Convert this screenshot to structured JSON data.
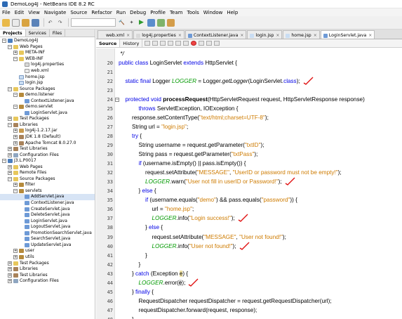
{
  "window": {
    "title": "DemoLog4J - NetBeans IDE 8.2 RC"
  },
  "menubar": [
    "File",
    "Edit",
    "View",
    "Navigate",
    "Source",
    "Refactor",
    "Run",
    "Debug",
    "Profile",
    "Team",
    "Tools",
    "Window",
    "Help"
  ],
  "left_tabs": [
    "Projects",
    "Services",
    "Files"
  ],
  "tree": [
    {
      "label": "DemoLog4J",
      "toggle": "−",
      "icon": "proj"
    },
    {
      "label": "Web Pages",
      "toggle": "−",
      "icon": "folder"
    },
    {
      "label": "META-INF",
      "toggle": "+",
      "icon": "folder"
    },
    {
      "label": "WEB-INF",
      "toggle": "−",
      "icon": "folder"
    },
    {
      "label": "log4j.properties",
      "toggle": "",
      "icon": "prop"
    },
    {
      "label": "web.xml",
      "toggle": "",
      "icon": "xml"
    },
    {
      "label": "home.jsp",
      "toggle": "",
      "icon": "jsp"
    },
    {
      "label": "login.jsp",
      "toggle": "",
      "icon": "jsp"
    },
    {
      "label": "Source Packages",
      "toggle": "−",
      "icon": "folder"
    },
    {
      "label": "demo.listener",
      "toggle": "−",
      "icon": "pkg"
    },
    {
      "label": "ContextListener.java",
      "toggle": "",
      "icon": "java"
    },
    {
      "label": "demo.servlet",
      "toggle": "−",
      "icon": "pkg"
    },
    {
      "label": "LoginServlet.java",
      "toggle": "",
      "icon": "java"
    },
    {
      "label": "Test Packages",
      "toggle": "+",
      "icon": "folder"
    },
    {
      "label": "Libraries",
      "toggle": "−",
      "icon": "lib"
    },
    {
      "label": "log4j-1.2.17.jar",
      "toggle": "+",
      "icon": "jar"
    },
    {
      "label": "JDK 1.8 (Default)",
      "toggle": "+",
      "icon": "lib"
    },
    {
      "label": "Apache Tomcat 8.0.27.0",
      "toggle": "+",
      "icon": "lib"
    },
    {
      "label": "Test Libraries",
      "toggle": "+",
      "icon": "lib"
    },
    {
      "label": "Configuration Files",
      "toggle": "+",
      "icon": "cfg"
    },
    {
      "label": "J3.L.P0017",
      "toggle": "−",
      "icon": "proj"
    },
    {
      "label": "Web Pages",
      "toggle": "+",
      "icon": "folder"
    },
    {
      "label": "Remote Files",
      "toggle": "+",
      "icon": "folder"
    },
    {
      "label": "Source Packages",
      "toggle": "−",
      "icon": "folder"
    },
    {
      "label": "filter",
      "toggle": "+",
      "icon": "pkg"
    },
    {
      "label": "servlets",
      "toggle": "−",
      "icon": "pkg"
    },
    {
      "label": "AddServlet.java",
      "toggle": "",
      "icon": "java"
    },
    {
      "label": "ContextListener.java",
      "toggle": "",
      "icon": "java"
    },
    {
      "label": "CreateServlet.java",
      "toggle": "",
      "icon": "java"
    },
    {
      "label": "DeleteServlet.java",
      "toggle": "",
      "icon": "java"
    },
    {
      "label": "LoginServlet.java",
      "toggle": "",
      "icon": "java"
    },
    {
      "label": "LogoutServlet.java",
      "toggle": "",
      "icon": "java"
    },
    {
      "label": "PromotionSearchServlet.java",
      "toggle": "",
      "icon": "java"
    },
    {
      "label": "SearchServlet.java",
      "toggle": "",
      "icon": "java"
    },
    {
      "label": "UpdateServlet.java",
      "toggle": "",
      "icon": "java"
    },
    {
      "label": "user",
      "toggle": "+",
      "icon": "pkg"
    },
    {
      "label": "utils",
      "toggle": "+",
      "icon": "pkg"
    },
    {
      "label": "Test Packages",
      "toggle": "+",
      "icon": "folder"
    },
    {
      "label": "Libraries",
      "toggle": "+",
      "icon": "lib"
    },
    {
      "label": "Test Libraries",
      "toggle": "+",
      "icon": "lib"
    },
    {
      "label": "Configuration Files",
      "toggle": "+",
      "icon": "cfg"
    }
  ],
  "file_tabs": [
    {
      "label": "web.xml",
      "active": false
    },
    {
      "label": "log4j.properties",
      "active": false
    },
    {
      "label": "ContextListener.java",
      "active": false
    },
    {
      "label": "login.jsp",
      "active": false
    },
    {
      "label": "home.jsp",
      "active": false
    },
    {
      "label": "LoginServlet.java",
      "active": true
    }
  ],
  "editor_modes": [
    "Source",
    "History"
  ],
  "code_lines": [
    {
      "n": "",
      "indent": 0,
      "fold": "",
      "mark": false,
      "seg": [
        {
          "t": " */",
          "c": "em"
        }
      ]
    },
    {
      "n": "20",
      "indent": 0,
      "fold": "",
      "mark": false,
      "seg": [
        {
          "t": "public class ",
          "c": "kw"
        },
        {
          "t": "LoginServlet ",
          "c": ""
        },
        {
          "t": "extends ",
          "c": "kw"
        },
        {
          "t": "HttpServlet {",
          "c": ""
        }
      ]
    },
    {
      "n": "21",
      "indent": 0,
      "fold": "",
      "mark": false,
      "seg": []
    },
    {
      "n": "22",
      "indent": 1,
      "fold": "",
      "mark": true,
      "seg": [
        {
          "t": "static final ",
          "c": "kw"
        },
        {
          "t": "Logger ",
          "c": ""
        },
        {
          "t": "LOGGER",
          "c": "fld"
        },
        {
          "t": " = Logger.",
          "c": ""
        },
        {
          "t": "getLogger",
          "c": "em"
        },
        {
          "t": "(LoginServlet.",
          "c": ""
        },
        {
          "t": "class",
          "c": "kw"
        },
        {
          "t": ");",
          "c": ""
        }
      ]
    },
    {
      "n": "23",
      "indent": 0,
      "fold": "",
      "mark": false,
      "seg": []
    },
    {
      "n": "24",
      "indent": 1,
      "fold": "−",
      "mark": false,
      "seg": [
        {
          "t": "protected void ",
          "c": "kw"
        },
        {
          "t": "processRequest",
          "c": "b"
        },
        {
          "t": "(HttpServletRequest request, HttpServletResponse response)",
          "c": ""
        }
      ]
    },
    {
      "n": "25",
      "indent": 3,
      "fold": "",
      "mark": false,
      "seg": [
        {
          "t": "throws ",
          "c": "kw"
        },
        {
          "t": "ServletException, IOException {",
          "c": ""
        }
      ]
    },
    {
      "n": "26",
      "indent": 2,
      "fold": "",
      "mark": false,
      "seg": [
        {
          "t": "response.setContentType(",
          "c": ""
        },
        {
          "t": "\"text/html;charset=UTF-8\"",
          "c": "str"
        },
        {
          "t": ");",
          "c": ""
        }
      ]
    },
    {
      "n": "27",
      "indent": 2,
      "fold": "",
      "mark": false,
      "seg": [
        {
          "t": "String url = ",
          "c": ""
        },
        {
          "t": "\"login.jsp\"",
          "c": "str"
        },
        {
          "t": ";",
          "c": ""
        }
      ]
    },
    {
      "n": "28",
      "indent": 2,
      "fold": "",
      "mark": false,
      "seg": [
        {
          "t": "try ",
          "c": "kw"
        },
        {
          "t": "{",
          "c": ""
        }
      ]
    },
    {
      "n": "29",
      "indent": 3,
      "fold": "",
      "mark": false,
      "seg": [
        {
          "t": "String username = request.getParameter(",
          "c": ""
        },
        {
          "t": "\"txtID\"",
          "c": "str"
        },
        {
          "t": ");",
          "c": ""
        }
      ]
    },
    {
      "n": "30",
      "indent": 3,
      "fold": "",
      "mark": false,
      "seg": [
        {
          "t": "String pass = request.getParameter(",
          "c": ""
        },
        {
          "t": "\"txtPass\"",
          "c": "str"
        },
        {
          "t": ");",
          "c": ""
        }
      ]
    },
    {
      "n": "31",
      "indent": 3,
      "fold": "",
      "mark": false,
      "seg": [
        {
          "t": "if ",
          "c": "kw"
        },
        {
          "t": "(username.isEmpty() || pass.isEmpty()) {",
          "c": ""
        }
      ]
    },
    {
      "n": "32",
      "indent": 4,
      "fold": "",
      "mark": false,
      "seg": [
        {
          "t": "request.setAttribute(",
          "c": ""
        },
        {
          "t": "\"MESSAGE\"",
          "c": "str"
        },
        {
          "t": ", ",
          "c": ""
        },
        {
          "t": "\"UserID or password must not be empty!\"",
          "c": "str"
        },
        {
          "t": ");",
          "c": ""
        }
      ]
    },
    {
      "n": "33",
      "indent": 4,
      "fold": "",
      "mark": true,
      "seg": [
        {
          "t": "LOGGER",
          "c": "fld"
        },
        {
          "t": ".warn(",
          "c": ""
        },
        {
          "t": "\"User not fill in userID or Password!\"",
          "c": "str"
        },
        {
          "t": ");",
          "c": ""
        }
      ]
    },
    {
      "n": "34",
      "indent": 3,
      "fold": "",
      "mark": false,
      "seg": [
        {
          "t": "} ",
          "c": ""
        },
        {
          "t": "else ",
          "c": "kw"
        },
        {
          "t": "{",
          "c": ""
        }
      ]
    },
    {
      "n": "35",
      "indent": 4,
      "fold": "",
      "mark": false,
      "seg": [
        {
          "t": "if ",
          "c": "kw"
        },
        {
          "t": "(username.equals(",
          "c": ""
        },
        {
          "t": "\"demo\"",
          "c": "str"
        },
        {
          "t": ") && pass.equals(",
          "c": ""
        },
        {
          "t": "\"password\"",
          "c": "str"
        },
        {
          "t": ")) {",
          "c": ""
        }
      ]
    },
    {
      "n": "36",
      "indent": 5,
      "fold": "",
      "mark": false,
      "seg": [
        {
          "t": "url = ",
          "c": ""
        },
        {
          "t": "\"home.jsp\"",
          "c": "str"
        },
        {
          "t": ";",
          "c": ""
        }
      ]
    },
    {
      "n": "37",
      "indent": 5,
      "fold": "",
      "mark": true,
      "seg": [
        {
          "t": "LOGGER",
          "c": "fld"
        },
        {
          "t": ".info(",
          "c": ""
        },
        {
          "t": "\"Login success!\"",
          "c": "str"
        },
        {
          "t": ");",
          "c": ""
        }
      ]
    },
    {
      "n": "38",
      "indent": 4,
      "fold": "",
      "mark": false,
      "seg": [
        {
          "t": "} ",
          "c": ""
        },
        {
          "t": "else ",
          "c": "kw"
        },
        {
          "t": "{",
          "c": ""
        }
      ]
    },
    {
      "n": "39",
      "indent": 5,
      "fold": "",
      "mark": false,
      "seg": [
        {
          "t": "request.setAttribute(",
          "c": ""
        },
        {
          "t": "\"MESSAGE\"",
          "c": "str"
        },
        {
          "t": ", ",
          "c": ""
        },
        {
          "t": "\"User not found!\"",
          "c": "str"
        },
        {
          "t": ");",
          "c": ""
        }
      ]
    },
    {
      "n": "40",
      "indent": 5,
      "fold": "",
      "mark": true,
      "seg": [
        {
          "t": "LOGGER",
          "c": "fld"
        },
        {
          "t": ".info(",
          "c": ""
        },
        {
          "t": "\"User not found!\"",
          "c": "str"
        },
        {
          "t": ");",
          "c": ""
        }
      ]
    },
    {
      "n": "41",
      "indent": 4,
      "fold": "",
      "mark": false,
      "seg": [
        {
          "t": "}",
          "c": ""
        }
      ]
    },
    {
      "n": "42",
      "indent": 3,
      "fold": "",
      "mark": false,
      "seg": [
        {
          "t": "}",
          "c": ""
        }
      ]
    },
    {
      "n": "43",
      "indent": 2,
      "fold": "",
      "mark": false,
      "seg": [
        {
          "t": "} ",
          "c": ""
        },
        {
          "t": "catch ",
          "c": "kw"
        },
        {
          "t": "(Exception ",
          "c": ""
        },
        {
          "t": "e",
          "c": "hl-paren"
        },
        {
          "t": ") {",
          "c": ""
        }
      ]
    },
    {
      "n": "44",
      "indent": 3,
      "fold": "",
      "mark": true,
      "seg": [
        {
          "t": "LOGGER",
          "c": "fld"
        },
        {
          "t": ".error(",
          "c": ""
        },
        {
          "t": "e",
          "c": "hl-e"
        },
        {
          "t": ");",
          "c": ""
        }
      ]
    },
    {
      "n": "45",
      "indent": 2,
      "fold": "",
      "mark": false,
      "seg": [
        {
          "t": "} ",
          "c": ""
        },
        {
          "t": "finally ",
          "c": "kw"
        },
        {
          "t": "{",
          "c": ""
        }
      ]
    },
    {
      "n": "46",
      "indent": 3,
      "fold": "",
      "mark": false,
      "seg": [
        {
          "t": "RequestDispatcher requestDispatcher = request.getRequestDispatcher(url);",
          "c": ""
        }
      ]
    },
    {
      "n": "47",
      "indent": 3,
      "fold": "",
      "mark": false,
      "seg": [
        {
          "t": "requestDispatcher.forward(request, response);",
          "c": ""
        }
      ]
    },
    {
      "n": "48",
      "indent": 2,
      "fold": "",
      "mark": false,
      "seg": [
        {
          "t": "}",
          "c": ""
        }
      ]
    },
    {
      "n": "49",
      "indent": 1,
      "fold": "",
      "mark": false,
      "seg": [
        {
          "t": "}",
          "c": ""
        }
      ]
    }
  ],
  "colors": {
    "keyword": "#0000e6",
    "string": "#ce7b00",
    "field": "#009900",
    "annotation_mark": "#e01010"
  }
}
